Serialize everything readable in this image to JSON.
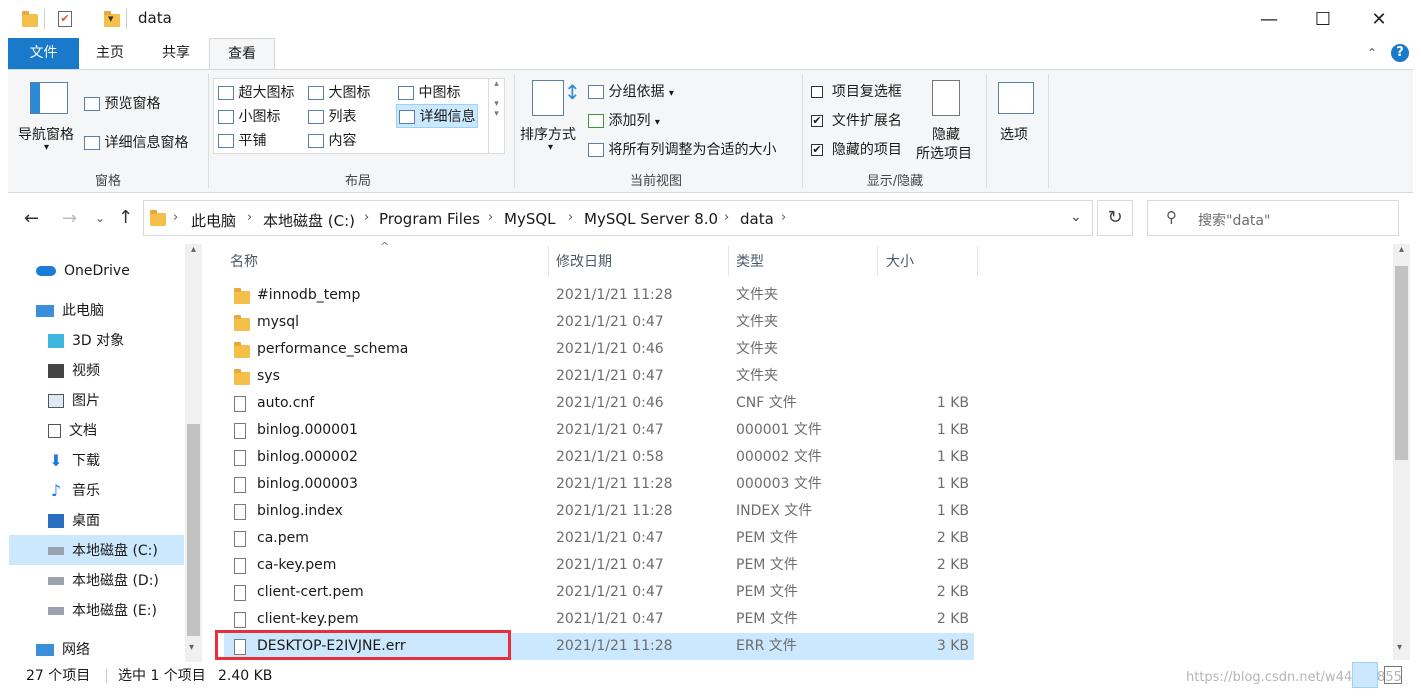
{
  "window": {
    "title": "data",
    "minimize": "—",
    "maximize": "☐",
    "close": "✕"
  },
  "tabs": {
    "file": "文件",
    "home": "主页",
    "share": "共享",
    "view": "查看"
  },
  "ribbon": {
    "panes": {
      "nav_pane": "导航窗格",
      "preview_pane": "预览窗格",
      "details_pane": "详细信息窗格",
      "group_label": "窗格"
    },
    "layout": {
      "extra_large": "超大图标",
      "large": "大图标",
      "medium": "中图标",
      "small": "小图标",
      "list": "列表",
      "details": "详细信息",
      "tiles": "平铺",
      "content": "内容",
      "group_label": "布局"
    },
    "current_view": {
      "sort_by": "排序方式",
      "group_by": "分组依据",
      "add_columns": "添加列",
      "size_all_columns": "将所有列调整为合适的大小",
      "group_label": "当前视图"
    },
    "show_hide": {
      "item_checkboxes": "项目复选框",
      "file_extensions": "文件扩展名",
      "hidden_items": "隐藏的项目",
      "hide_selected_1": "隐藏",
      "hide_selected_2": "所选项目",
      "group_label": "显示/隐藏",
      "checkmark": "✔"
    },
    "options": "选项"
  },
  "address": {
    "breadcrumb": [
      "此电脑",
      "本地磁盘 (C:)",
      "Program Files",
      "MySQL",
      "MySQL Server 8.0",
      "data"
    ],
    "search_placeholder": "搜索\"data\""
  },
  "nav": {
    "items": [
      "OneDrive",
      "此电脑",
      "3D 对象",
      "视频",
      "图片",
      "文档",
      "下载",
      "音乐",
      "桌面",
      "本地磁盘 (C:)",
      "本地磁盘 (D:)",
      "本地磁盘 (E:)",
      "网络"
    ]
  },
  "columns": {
    "name": "名称",
    "date": "修改日期",
    "type": "类型",
    "size": "大小"
  },
  "files": [
    {
      "name": "#innodb_temp",
      "date": "2021/1/21 11:28",
      "type": "文件夹",
      "size": "",
      "kind": "folder"
    },
    {
      "name": "mysql",
      "date": "2021/1/21 0:47",
      "type": "文件夹",
      "size": "",
      "kind": "folder"
    },
    {
      "name": "performance_schema",
      "date": "2021/1/21 0:46",
      "type": "文件夹",
      "size": "",
      "kind": "folder"
    },
    {
      "name": "sys",
      "date": "2021/1/21 0:47",
      "type": "文件夹",
      "size": "",
      "kind": "folder"
    },
    {
      "name": "auto.cnf",
      "date": "2021/1/21 0:46",
      "type": "CNF 文件",
      "size": "1 KB",
      "kind": "file"
    },
    {
      "name": "binlog.000001",
      "date": "2021/1/21 0:47",
      "type": "000001 文件",
      "size": "1 KB",
      "kind": "file"
    },
    {
      "name": "binlog.000002",
      "date": "2021/1/21 0:58",
      "type": "000002 文件",
      "size": "1 KB",
      "kind": "file"
    },
    {
      "name": "binlog.000003",
      "date": "2021/1/21 11:28",
      "type": "000003 文件",
      "size": "1 KB",
      "kind": "file"
    },
    {
      "name": "binlog.index",
      "date": "2021/1/21 11:28",
      "type": "INDEX 文件",
      "size": "1 KB",
      "kind": "file"
    },
    {
      "name": "ca.pem",
      "date": "2021/1/21 0:47",
      "type": "PEM 文件",
      "size": "2 KB",
      "kind": "file"
    },
    {
      "name": "ca-key.pem",
      "date": "2021/1/21 0:47",
      "type": "PEM 文件",
      "size": "2 KB",
      "kind": "file"
    },
    {
      "name": "client-cert.pem",
      "date": "2021/1/21 0:47",
      "type": "PEM 文件",
      "size": "2 KB",
      "kind": "file"
    },
    {
      "name": "client-key.pem",
      "date": "2021/1/21 0:47",
      "type": "PEM 文件",
      "size": "2 KB",
      "kind": "file"
    },
    {
      "name": "DESKTOP-E2IVJNE.err",
      "date": "2021/1/21 11:28",
      "type": "ERR 文件",
      "size": "3 KB",
      "kind": "file",
      "selected": true
    }
  ],
  "status": {
    "count": "27 个项目",
    "selected": "选中 1 个项目",
    "size": "2.40 KB"
  },
  "watermark": "https://blog.csdn.net/w44832855",
  "colors": {
    "file_tab": "#1979ca",
    "selection": "#cce8ff",
    "highlight_box": "#e8303a"
  }
}
